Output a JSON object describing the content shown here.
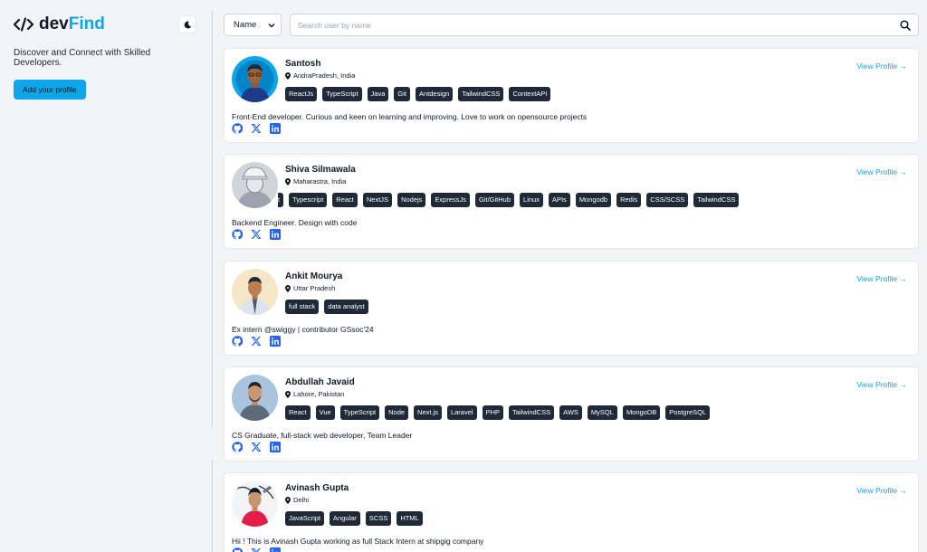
{
  "brand": {
    "part1": "dev",
    "part2": "Find"
  },
  "sidebar": {
    "tagline": "Discover and Connect with Skilled Developers.",
    "add_profile_label": "Add your profile"
  },
  "search": {
    "select_value": "Name",
    "placeholder": "Search user by name"
  },
  "view_profile_label": "View Profile →",
  "profiles": [
    {
      "name": "Santosh",
      "location": "AndraPradesh, India",
      "skills": [
        "ReactJs",
        "TypeScript",
        "Java",
        "Git",
        "Antdesign",
        "TailwindCSS",
        "ContextAPI"
      ],
      "bio": "Front-End developer. Curious and keen on learning and improving. Love to work on opensource projects"
    },
    {
      "name": "Shiva Silmawala",
      "location": "Maharastra, India",
      "skills": [
        "t",
        "Typescript",
        "React",
        "NextJS",
        "Nodejs",
        "ExpressJs",
        "Git/GitHub",
        "Linux",
        "APIs",
        "Mongodb",
        "Redis",
        "CSS/SCSS",
        "TailwindCSS"
      ],
      "bio": "Backend Engineer. Design with code"
    },
    {
      "name": "Ankit Mourya",
      "location": "Uttar Pradesh",
      "skills": [
        "full stack",
        "data analyst"
      ],
      "bio": "Ex intern @swiggy | contributor GSsoc'24"
    },
    {
      "name": "Abdullah Javaid",
      "location": "Lahore, Pakistan",
      "skills": [
        "React",
        "Vue",
        "TypeScript",
        "Node",
        "Next.js",
        "Laravel",
        "PHP",
        "TailwindCSS",
        "AWS",
        "MySQL",
        "MongoDB",
        "PostgreSQL"
      ],
      "bio": "CS Graduate, full-stack web developer, Team Leader"
    },
    {
      "name": "Avinash Gupta",
      "location": "Delhi",
      "skills": [
        "JavaScript",
        "Angular",
        "SCSS",
        "HTML"
      ],
      "bio": "Hii ! This is Avinash Gupta working as full Stack Intern at shipgig company"
    }
  ],
  "colors": {
    "accent": "#0ea5e9",
    "chip_bg": "#1f2937",
    "social": "#2563eb"
  }
}
